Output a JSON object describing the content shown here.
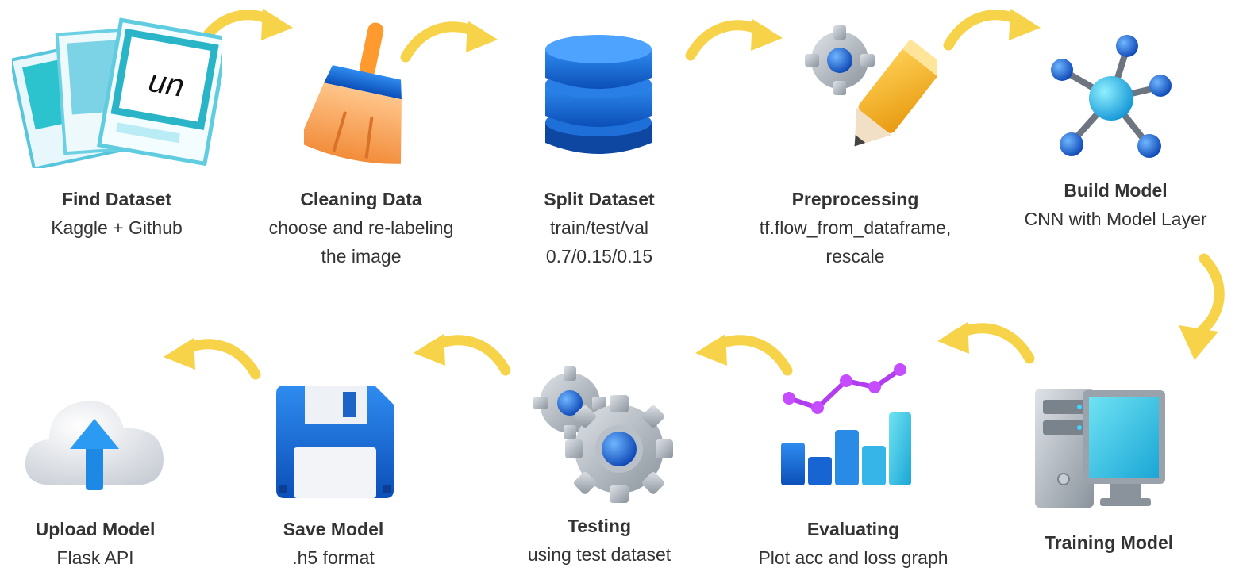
{
  "steps": [
    {
      "title": "Find Dataset",
      "desc": [
        "Kaggle + Github"
      ],
      "icon": "photos-icon",
      "logo_text": "un"
    },
    {
      "title": "Cleaning Data",
      "desc": [
        "choose and re-labeling",
        "the image"
      ],
      "icon": "broom-icon"
    },
    {
      "title": "Split Dataset",
      "desc": [
        "train/test/val",
        "0.7/0.15/0.15"
      ],
      "icon": "database-icon"
    },
    {
      "title": "Preprocessing",
      "desc": [
        "tf.flow_from_dataframe,",
        "rescale"
      ],
      "icon": "gear-pencil-icon"
    },
    {
      "title": "Build Model",
      "desc": [
        "CNN with Model Layer"
      ],
      "icon": "network-icon"
    },
    {
      "title": "Training Model",
      "desc": [],
      "icon": "computer-icon"
    },
    {
      "title": "Evaluating",
      "desc": [
        "Plot acc and loss graph"
      ],
      "icon": "chart-icon"
    },
    {
      "title": "Testing",
      "desc": [
        "using test dataset"
      ],
      "icon": "gears-icon"
    },
    {
      "title": "Save Model",
      "desc": [
        ".h5 format"
      ],
      "icon": "floppy-icon"
    },
    {
      "title": "Upload Model",
      "desc": [
        "Flask API"
      ],
      "icon": "cloud-upload-icon"
    }
  ],
  "colors": {
    "arrow": "#f7d34a",
    "text": "#333333",
    "blue": "#1e88e5",
    "cyan": "#2ec4d6"
  }
}
